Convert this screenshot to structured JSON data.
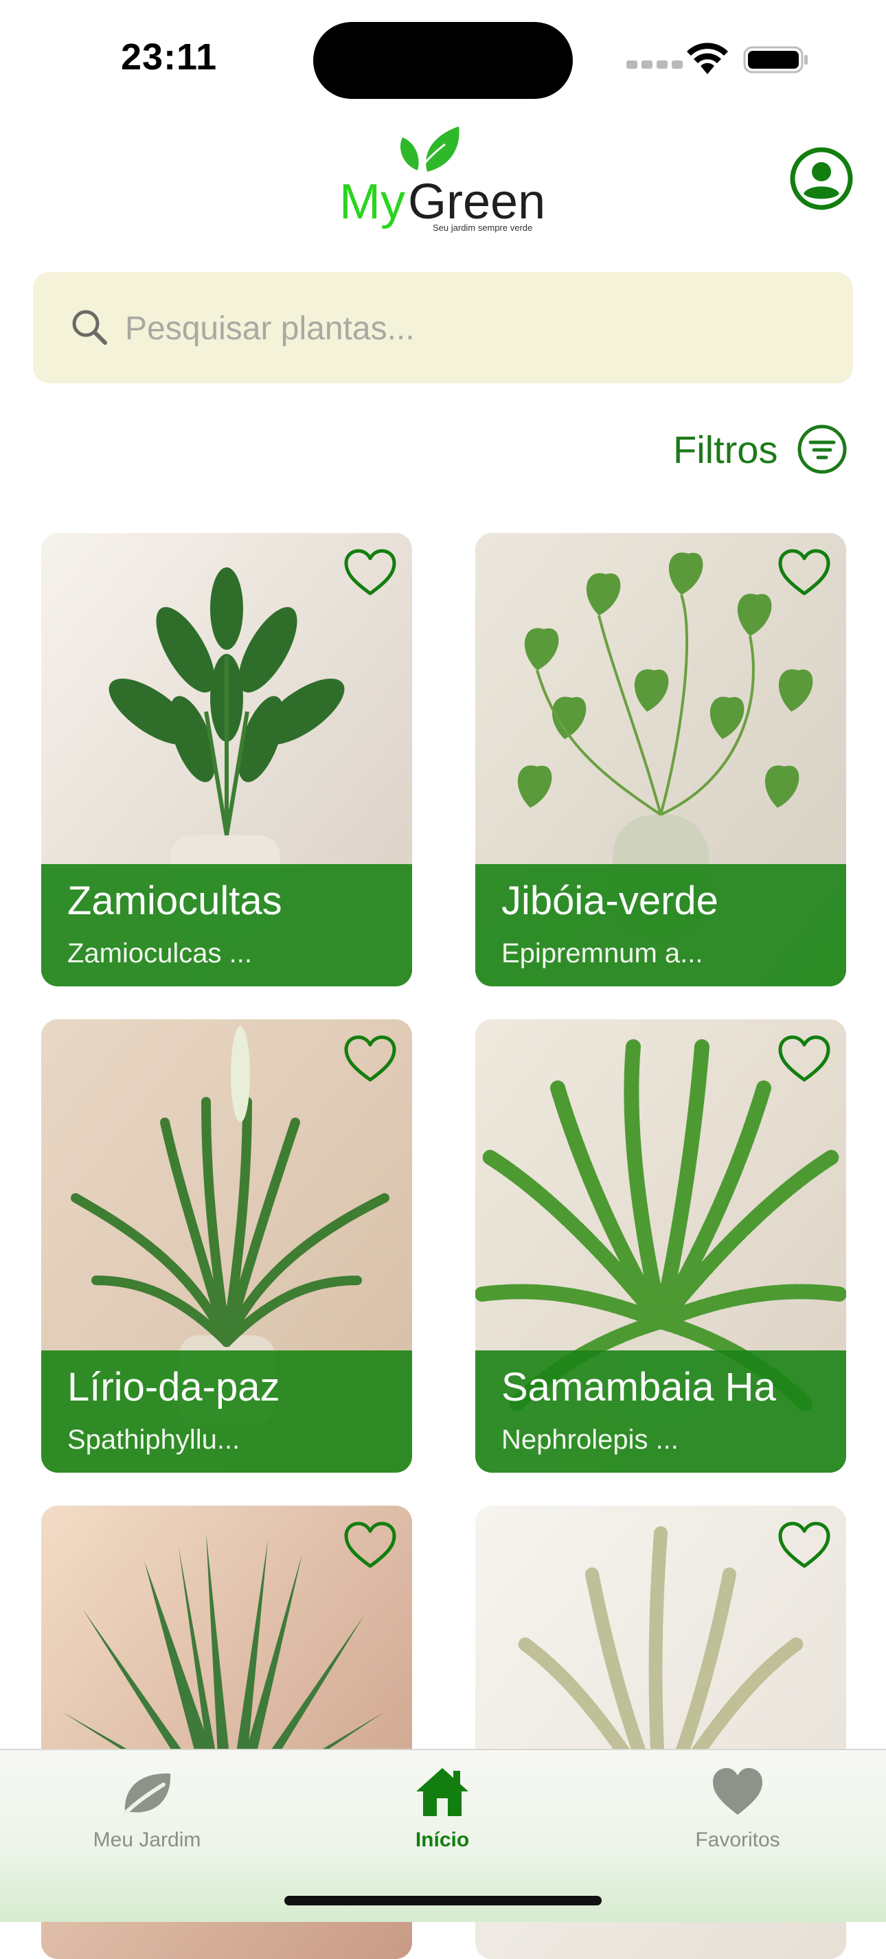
{
  "status_bar": {
    "time": "23:11"
  },
  "header": {
    "logo": {
      "my": "My",
      "green": "Green",
      "tagline": "Seu jardim sempre verde"
    }
  },
  "search": {
    "placeholder": "Pesquisar plantas...",
    "value": ""
  },
  "filters": {
    "label": "Filtros"
  },
  "plants": [
    {
      "name": "Zamiocultas",
      "scientific": "Zamioculcas ..."
    },
    {
      "name": "Jibóia-verde",
      "scientific": "Epipremnum a..."
    },
    {
      "name": "Lírio-da-paz",
      "scientific": "Spathiphyllu..."
    },
    {
      "name": "Samambaia Ha",
      "scientific": "Nephrolepis ..."
    },
    {
      "name": "",
      "scientific": ""
    },
    {
      "name": "",
      "scientific": ""
    }
  ],
  "tabs": [
    {
      "label": "Meu Jardim",
      "icon": "leaf-icon"
    },
    {
      "label": "Início",
      "icon": "home-icon",
      "active": true
    },
    {
      "label": "Favoritos",
      "icon": "heart-icon"
    }
  ],
  "colors": {
    "accent": "#1c7a18",
    "card_overlay": "#1c8416",
    "search_bg": "#f4f2d8"
  }
}
